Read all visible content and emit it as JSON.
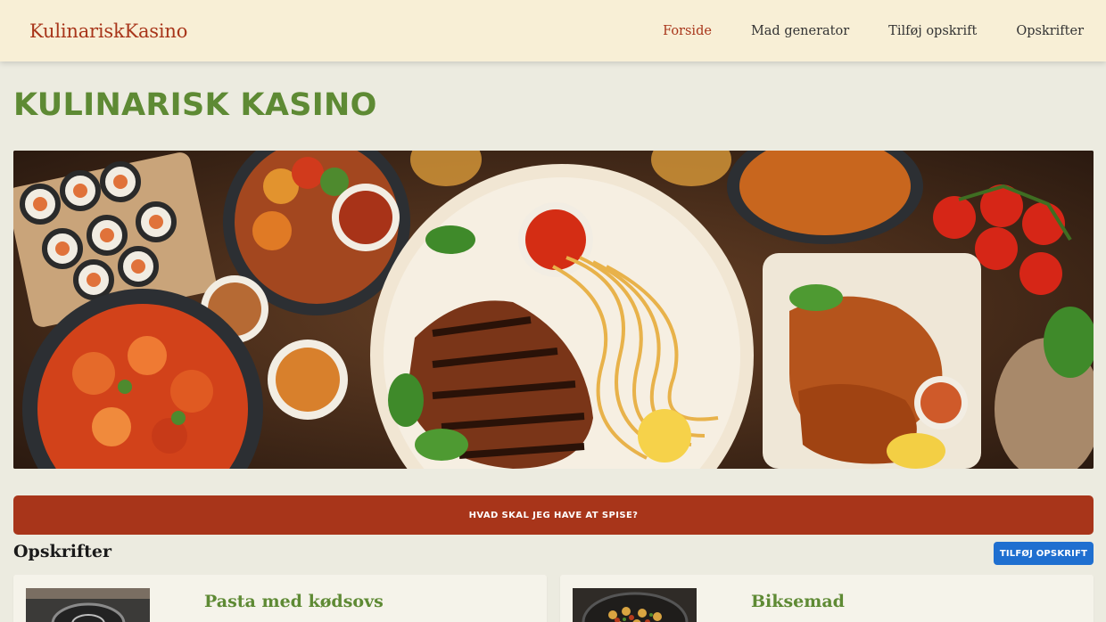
{
  "header": {
    "brand": "KulinariskKasino",
    "nav": [
      {
        "label": "Forside",
        "active": true
      },
      {
        "label": "Mad generator",
        "active": false
      },
      {
        "label": "Tilføj opskrift",
        "active": false
      },
      {
        "label": "Opskrifter",
        "active": false
      }
    ]
  },
  "main": {
    "title": "KULINARISK KASINO",
    "cta_label": "HVAD SKAL JEG HAVE AT SPISE?",
    "recipes_heading": "Opskrifter",
    "add_recipe_label": "TILFØJ OPSKRIFT",
    "recipes": [
      {
        "title": "Pasta med kødsovs"
      },
      {
        "title": "Biksemad"
      }
    ]
  },
  "colors": {
    "accent": "#a8351a",
    "title_green": "#5e8a34",
    "button_blue": "#1f6fd0",
    "header_bg": "#f8efd6",
    "page_bg": "#ecebe0"
  }
}
